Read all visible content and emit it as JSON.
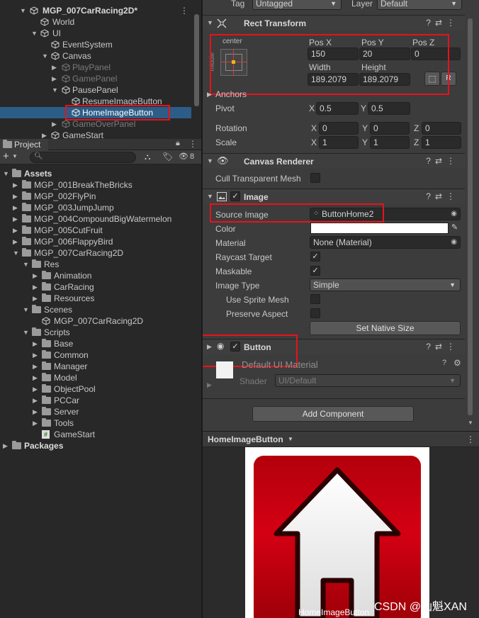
{
  "hierarchy": {
    "scene": "MGP_007CarRacing2D*",
    "items": [
      {
        "label": "World",
        "dim": false
      },
      {
        "label": "UI",
        "dim": false
      },
      {
        "label": "EventSystem",
        "dim": false
      },
      {
        "label": "Canvas",
        "dim": false
      },
      {
        "label": "PlayPanel",
        "dim": true
      },
      {
        "label": "GamePanel",
        "dim": true
      },
      {
        "label": "PausePanel",
        "dim": false
      },
      {
        "label": "ResumeImageButton",
        "dim": false
      },
      {
        "label": "HomeImageButton",
        "dim": false
      },
      {
        "label": "GameOverPanel",
        "dim": true
      },
      {
        "label": "GameStart",
        "dim": false
      }
    ]
  },
  "project": {
    "tab": "Project",
    "hidden_count": "8",
    "tree": [
      {
        "label": "Assets",
        "bold": true
      },
      {
        "label": "MGP_001BreakTheBricks"
      },
      {
        "label": "MGP_002FlyPin"
      },
      {
        "label": "MGP_003JumpJump"
      },
      {
        "label": "MGP_004CompoundBigWatermelon"
      },
      {
        "label": "MGP_005CutFruit"
      },
      {
        "label": "MGP_006FlappyBird"
      },
      {
        "label": "MGP_007CarRacing2D"
      },
      {
        "label": "Res"
      },
      {
        "label": "Animation"
      },
      {
        "label": "CarRacing"
      },
      {
        "label": "Resources"
      },
      {
        "label": "Scenes"
      },
      {
        "label": "MGP_007CarRacing2D"
      },
      {
        "label": "Scripts"
      },
      {
        "label": "Base"
      },
      {
        "label": "Common"
      },
      {
        "label": "Manager"
      },
      {
        "label": "Model"
      },
      {
        "label": "ObjectPool"
      },
      {
        "label": "PCCar"
      },
      {
        "label": "Server"
      },
      {
        "label": "Tools"
      },
      {
        "label": "GameStart"
      },
      {
        "label": "Packages",
        "bold": true
      }
    ]
  },
  "inspector": {
    "tag_label": "Tag",
    "tag_value": "Untagged",
    "layer_label": "Layer",
    "layer_value": "Default",
    "rect_transform": {
      "title": "Rect Transform",
      "anchor_preset": "center",
      "side_label": "middle",
      "pos_x_label": "Pos X",
      "pos_x": "150",
      "pos_y_label": "Pos Y",
      "pos_y": "20",
      "pos_z_label": "Pos Z",
      "pos_z": "0",
      "width_label": "Width",
      "width": "189.2079",
      "height_label": "Height",
      "height": "189.2079",
      "anchors_label": "Anchors",
      "pivot_label": "Pivot",
      "pivot_x": "0.5",
      "pivot_y": "0.5",
      "rotation_label": "Rotation",
      "rot_x": "0",
      "rot_y": "0",
      "rot_z": "0",
      "scale_label": "Scale",
      "scale_x": "1",
      "scale_y": "1",
      "scale_z": "1",
      "x": "X",
      "y": "Y",
      "z": "Z"
    },
    "canvas_renderer": {
      "title": "Canvas Renderer",
      "cull_label": "Cull Transparent Mesh"
    },
    "image": {
      "title": "Image",
      "source_label": "Source Image",
      "source_value": "ButtonHome2",
      "color_label": "Color",
      "material_label": "Material",
      "material_value": "None (Material)",
      "raycast_label": "Raycast Target",
      "maskable_label": "Maskable",
      "type_label": "Image Type",
      "type_value": "Simple",
      "sprite_mesh_label": "Use Sprite Mesh",
      "preserve_label": "Preserve Aspect",
      "native_size_button": "Set Native Size"
    },
    "button": {
      "title": "Button"
    },
    "material": {
      "name": "Default UI Material",
      "shader_label": "Shader",
      "shader_value": "UI/Default"
    },
    "add_component": "Add Component",
    "preview": {
      "object_name": "HomeImageButton",
      "caption": "HomeImageButton"
    }
  },
  "watermark": "CSDN @仙魁XAN",
  "colors": {
    "selection": "#2c5d87",
    "highlight": "#e8121b",
    "button_red": "#c3000e"
  }
}
